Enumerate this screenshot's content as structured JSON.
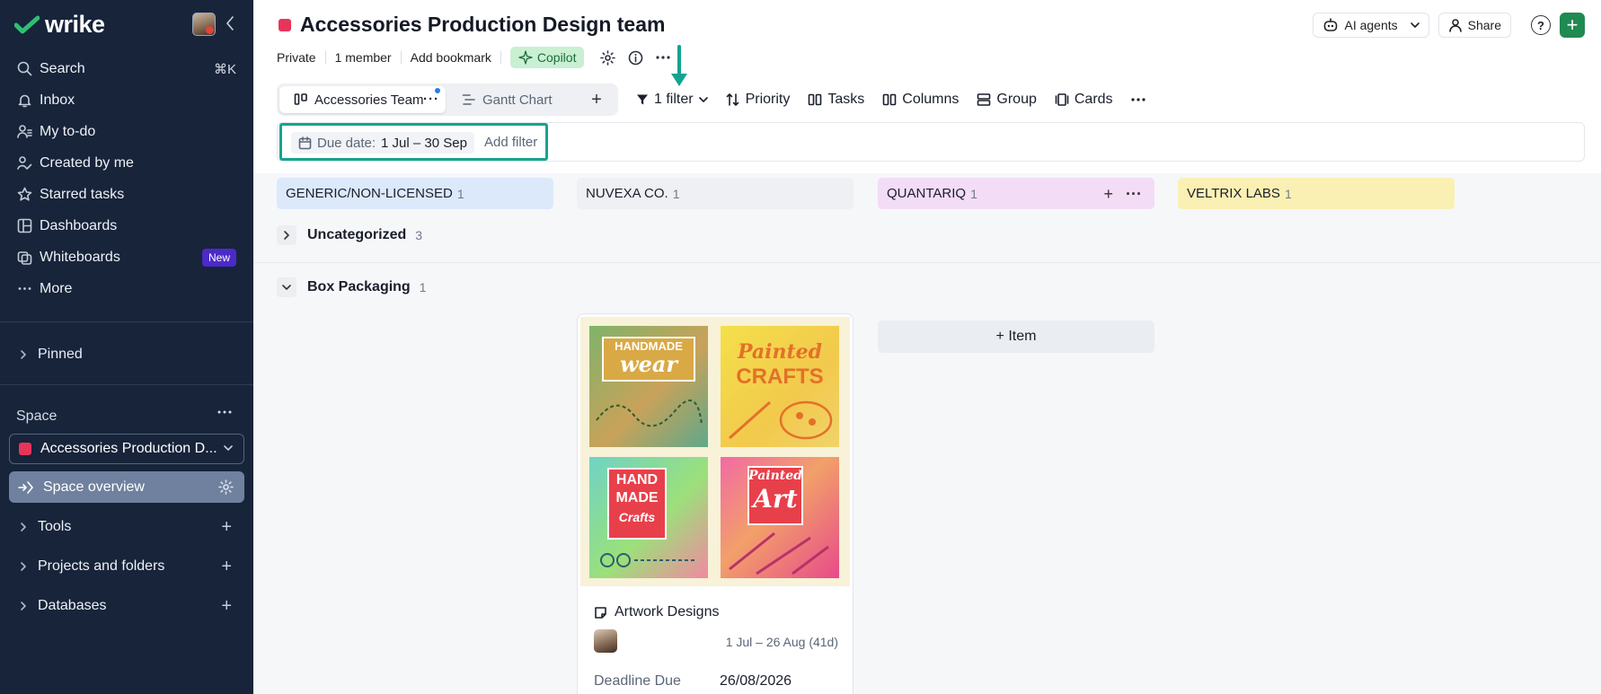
{
  "sidebar": {
    "logo_text": "wrike",
    "nav": [
      {
        "label": "Search",
        "icon": "search-icon",
        "shortcut": "⌘K"
      },
      {
        "label": "Inbox",
        "icon": "bell-icon"
      },
      {
        "label": "My to-do",
        "icon": "user-list-icon"
      },
      {
        "label": "Created by me",
        "icon": "user-pen-icon"
      },
      {
        "label": "Starred tasks",
        "icon": "star-icon"
      },
      {
        "label": "Dashboards",
        "icon": "dashboard-icon"
      },
      {
        "label": "Whiteboards",
        "icon": "whiteboard-icon",
        "badge": "New"
      },
      {
        "label": "More",
        "icon": "more-icon"
      }
    ],
    "pinned_label": "Pinned",
    "space_label": "Space",
    "space_name": "Accessories Production D...",
    "space_overview_label": "Space overview",
    "tree": [
      {
        "label": "Tools"
      },
      {
        "label": "Projects and folders"
      },
      {
        "label": "Databases"
      }
    ]
  },
  "header": {
    "title": "Accessories Production Design team",
    "privacy": "Private",
    "members": "1 member",
    "bookmark": "Add bookmark",
    "copilot": "Copilot",
    "ai_agents": "AI agents",
    "share": "Share",
    "help": "?"
  },
  "views": {
    "active_tab": "Accessories Team",
    "gantt_tab": "Gantt Chart"
  },
  "toolbar": {
    "filter": "1 filter",
    "priority": "Priority",
    "tasks": "Tasks",
    "columns": "Columns",
    "group": "Group",
    "cards": "Cards"
  },
  "filters": {
    "due_label": "Due date:",
    "due_value": "1 Jul – 30 Sep",
    "add_filter": "Add filter"
  },
  "colors": {
    "sidebar_bg": "#17243a",
    "highlight": "#16a48e",
    "brand_green": "#1f8a52"
  },
  "board": {
    "columns": [
      {
        "name": "GENERIC/NON-LICENSED",
        "count": "1",
        "color": "#dce9fb"
      },
      {
        "name": "NUVEXA CO.",
        "count": "1",
        "color": "#eef0f3"
      },
      {
        "name": "QUANTARIQ",
        "count": "1",
        "color": "#f3dcf6"
      },
      {
        "name": "VELTRIX LABS",
        "count": "1",
        "color": "#fbf0b3"
      }
    ],
    "groups": [
      {
        "name": "Uncategorized",
        "count": "3",
        "expanded": false
      },
      {
        "name": "Box Packaging",
        "count": "1",
        "expanded": true
      }
    ],
    "card": {
      "title": "Artwork Designs",
      "dates": "1 Jul – 26 Aug (41d)",
      "field_label": "Deadline Due",
      "field_value": "26/08/2026",
      "image_tiles": [
        {
          "line1": "HANDMADE",
          "line2": "wear"
        },
        {
          "line1": "Painted",
          "line2": "CRAFTS"
        },
        {
          "line1": "HAND",
          "line2": "MADE",
          "line3": "Crafts"
        },
        {
          "line1": "Painted",
          "line2": "Art"
        }
      ]
    },
    "add_item": "+ Item"
  }
}
